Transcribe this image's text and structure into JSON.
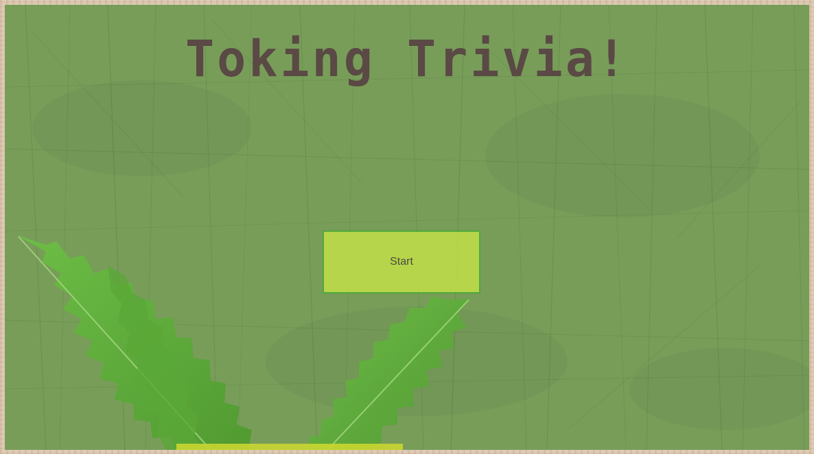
{
  "game": {
    "title": "Toking Trivia!",
    "start_label": "Start"
  },
  "colors": {
    "frame": "#dcc6ae",
    "panel": "#7f9c5f",
    "title": "#5a4944",
    "button_fill": "#c8e646",
    "button_border": "#4fa83a",
    "leaf": "#5fae3a"
  },
  "icons": {
    "decoration": "cannabis-leaf-icon"
  }
}
